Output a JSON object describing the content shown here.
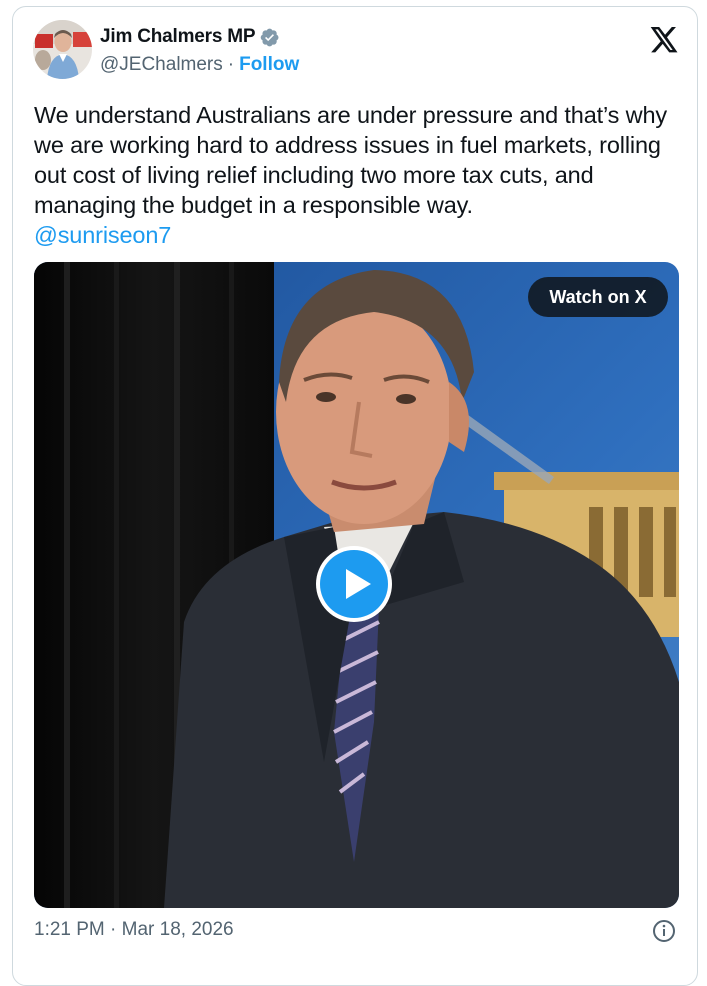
{
  "author": {
    "name": "Jim Chalmers MP",
    "handle": "@JEChalmers",
    "separator": "·",
    "follow_label": "Follow",
    "verified_icon": "verified-badge-icon",
    "verified_color": "#829aab"
  },
  "platform_logo": "x-logo-icon",
  "tweet": {
    "text": "We understand Australians are under pressure and that’s why we are working hard to address issues in fuel markets, rolling out cost of living relief including two more tax cuts, and managing the budget in a responsible way.",
    "mention": "@sunriseon7"
  },
  "media": {
    "watch_label": "Watch on X",
    "play_icon": "play-icon",
    "play_color": "#1d9bf0"
  },
  "footer": {
    "timestamp": "1:21 PM · Mar 18, 2026",
    "info_icon": "info-icon"
  },
  "colors": {
    "accent": "#1d9bf0",
    "text": "#0f1419",
    "secondary": "#536471",
    "border": "#cfd9de"
  }
}
